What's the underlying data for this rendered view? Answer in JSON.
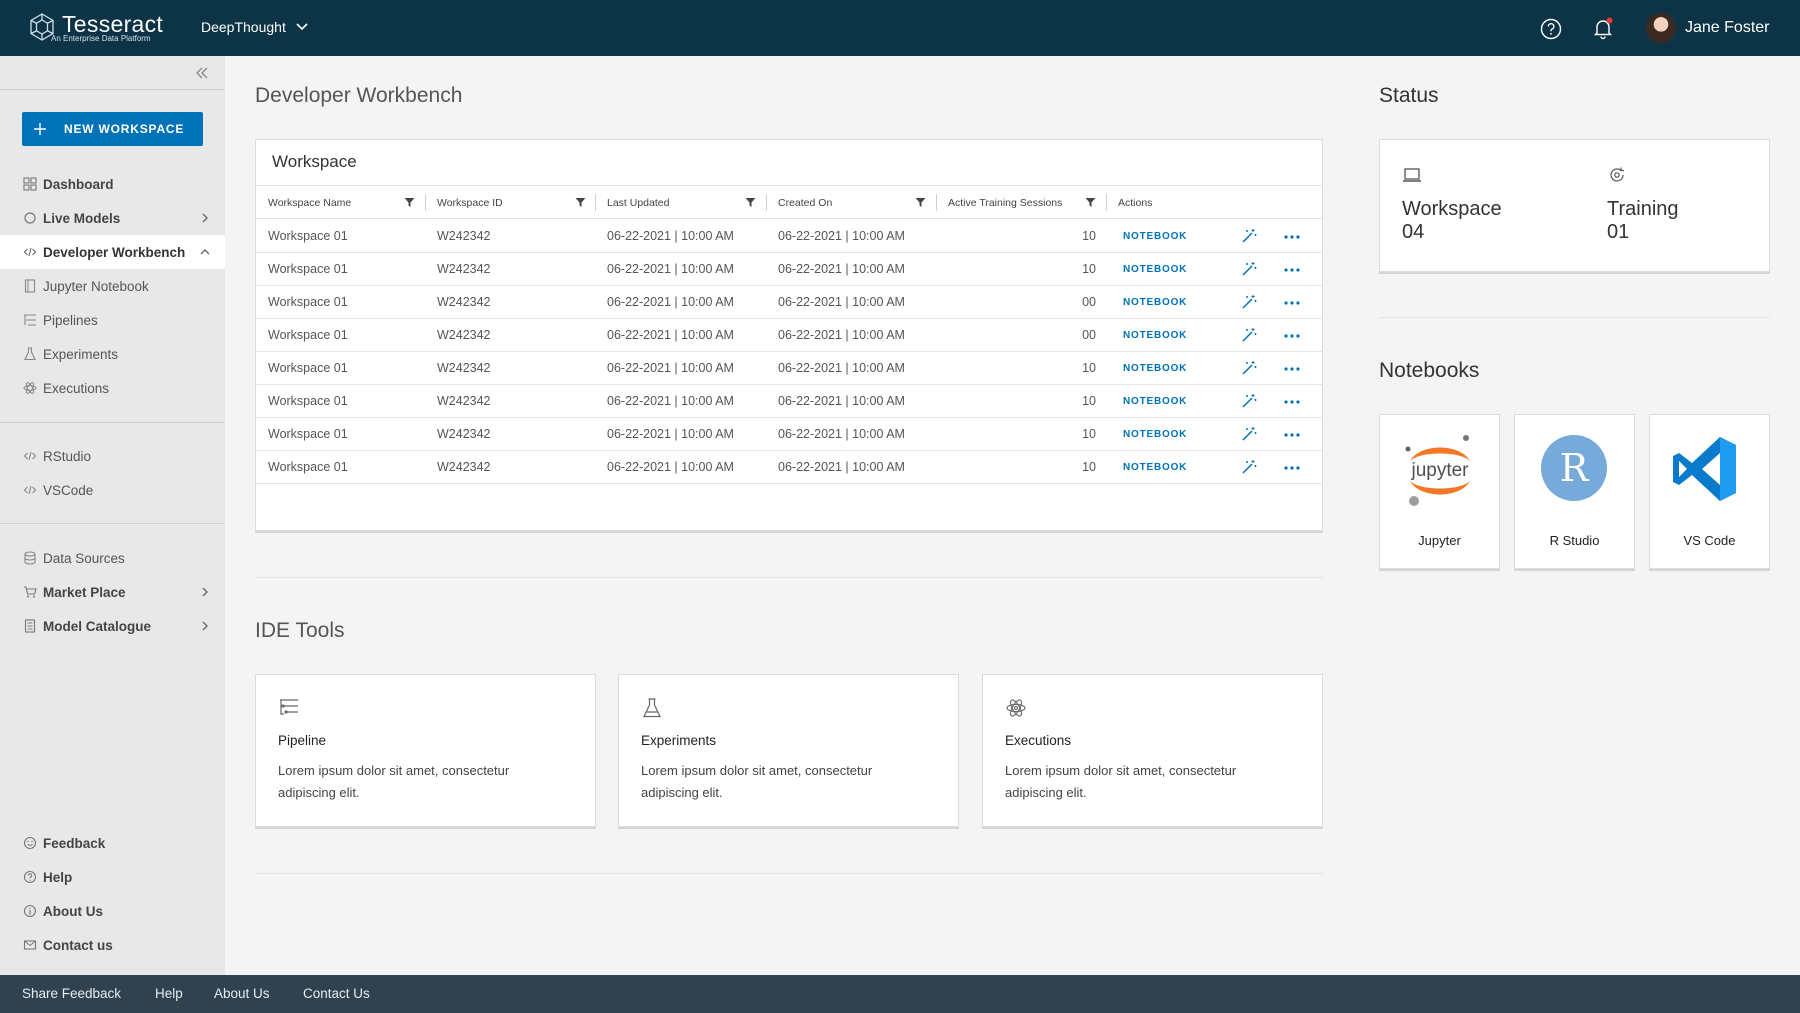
{
  "topbar": {
    "brand": "Tesseract",
    "tagline": "An Enterprise Data Platform",
    "tenant": "DeepThought",
    "user": "Jane Foster",
    "help_icon": "help-circle-icon",
    "bell_icon": "bell-icon",
    "accent": "#0c3346",
    "notification_dot": "#e53935"
  },
  "sidebar": {
    "new_workspace": "NEW WORKSPACE",
    "items": [
      {
        "label": "Dashboard",
        "icon": "grid-icon"
      },
      {
        "label": "Live Models",
        "icon": "circle-icon"
      },
      {
        "label": "Developer Workbench",
        "icon": "code-icon"
      },
      {
        "label": "Jupyter Notebook",
        "icon": "notebook-icon"
      },
      {
        "label": "Pipelines",
        "icon": "pipeline-icon"
      },
      {
        "label": "Experiments",
        "icon": "flask-icon"
      },
      {
        "label": "Executions",
        "icon": "atom-icon"
      },
      {
        "label": "RStudio",
        "icon": "code-icon"
      },
      {
        "label": "VSCode",
        "icon": "code-icon"
      },
      {
        "label": "Data Sources",
        "icon": "database-icon"
      },
      {
        "label": "Market Place",
        "icon": "cart-icon"
      },
      {
        "label": "Model Catalogue",
        "icon": "catalogue-icon"
      },
      {
        "label": "Feedback",
        "icon": "smile-icon"
      },
      {
        "label": "Help",
        "icon": "help-icon"
      },
      {
        "label": "About Us",
        "icon": "info-icon"
      },
      {
        "label": "Contact us",
        "icon": "mail-icon"
      }
    ]
  },
  "main": {
    "title": "Developer Workbench",
    "workspace": {
      "title": "Workspace",
      "columns": [
        "Workspace Name",
        "Workspace ID",
        "Last Updated",
        "Created On",
        "Active Training Sessions",
        "Actions"
      ],
      "rows": [
        {
          "name": "Workspace 01",
          "id": "W242342",
          "updated": "06-22-2021 | 10:00 AM",
          "created": "06-22-2021 | 10:00 AM",
          "sessions": "10",
          "action": "NOTEBOOK"
        },
        {
          "name": "Workspace 01",
          "id": "W242342",
          "updated": "06-22-2021 | 10:00 AM",
          "created": "06-22-2021 | 10:00 AM",
          "sessions": "10",
          "action": "NOTEBOOK"
        },
        {
          "name": "Workspace 01",
          "id": "W242342",
          "updated": "06-22-2021 | 10:00 AM",
          "created": "06-22-2021 | 10:00 AM",
          "sessions": "00",
          "action": "NOTEBOOK"
        },
        {
          "name": "Workspace 01",
          "id": "W242342",
          "updated": "06-22-2021 | 10:00 AM",
          "created": "06-22-2021 | 10:00 AM",
          "sessions": "00",
          "action": "NOTEBOOK"
        },
        {
          "name": "Workspace 01",
          "id": "W242342",
          "updated": "06-22-2021 | 10:00 AM",
          "created": "06-22-2021 | 10:00 AM",
          "sessions": "10",
          "action": "NOTEBOOK"
        },
        {
          "name": "Workspace 01",
          "id": "W242342",
          "updated": "06-22-2021 | 10:00 AM",
          "created": "06-22-2021 | 10:00 AM",
          "sessions": "10",
          "action": "NOTEBOOK"
        },
        {
          "name": "Workspace 01",
          "id": "W242342",
          "updated": "06-22-2021 | 10:00 AM",
          "created": "06-22-2021 | 10:00 AM",
          "sessions": "10",
          "action": "NOTEBOOK"
        },
        {
          "name": "Workspace 01",
          "id": "W242342",
          "updated": "06-22-2021 | 10:00 AM",
          "created": "06-22-2021 | 10:00 AM",
          "sessions": "10",
          "action": "NOTEBOOK"
        }
      ]
    },
    "ide": {
      "title": "IDE Tools",
      "tools": [
        {
          "title": "Pipeline",
          "desc": "Lorem ipsum dolor sit amet, consectetur adipiscing elit.",
          "icon": "pipeline-icon"
        },
        {
          "title": "Experiments",
          "desc": "Lorem ipsum dolor sit amet, consectetur adipiscing elit.",
          "icon": "flask-icon"
        },
        {
          "title": "Executions",
          "desc": "Lorem ipsum dolor sit amet, consectetur adipiscing elit.",
          "icon": "atom-icon"
        }
      ]
    }
  },
  "status": {
    "title": "Status",
    "items": [
      {
        "label": "Workspace",
        "value": "04",
        "icon": "laptop-icon"
      },
      {
        "label": "Training",
        "value": "01",
        "icon": "training-icon"
      }
    ]
  },
  "notebooks": {
    "title": "Notebooks",
    "items": [
      {
        "label": "Jupyter",
        "logo_text": "jupyter",
        "icon": "jupyter-logo"
      },
      {
        "label": "R Studio",
        "logo_text": "R",
        "icon": "rstudio-logo"
      },
      {
        "label": "VS Code",
        "icon": "vscode-logo"
      }
    ]
  },
  "footer": {
    "links": [
      "Share Feedback",
      "Help",
      "About Us",
      "Contact Us"
    ]
  }
}
